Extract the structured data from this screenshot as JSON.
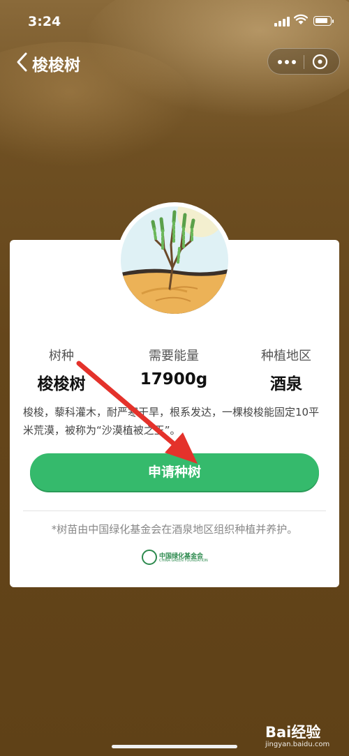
{
  "status": {
    "time": "3:24"
  },
  "nav": {
    "title": "梭梭树"
  },
  "stats": [
    {
      "label": "树种",
      "value": "梭梭树"
    },
    {
      "label": "需要能量",
      "value": "17900g"
    },
    {
      "label": "种植地区",
      "value": "酒泉"
    }
  ],
  "description": "梭梭，藜科灌木，耐严寒干旱，根系发达，一棵梭梭能固定10平米荒漠，被称为“沙漠植被之王”。",
  "apply_button": "申请种树",
  "footnote": "*树苗由中国绿化基金会在酒泉地区组织种植并养护。",
  "foundation": {
    "name_cn": "中国绿化基金会",
    "name_en": "CHINA GREEN FOUNDATION"
  },
  "watermark": {
    "brand": "Bai经验",
    "url": "jingyan.baidu.com"
  },
  "colors": {
    "accent_green": "#35ba6c",
    "annotation_arrow": "#e4322b"
  }
}
